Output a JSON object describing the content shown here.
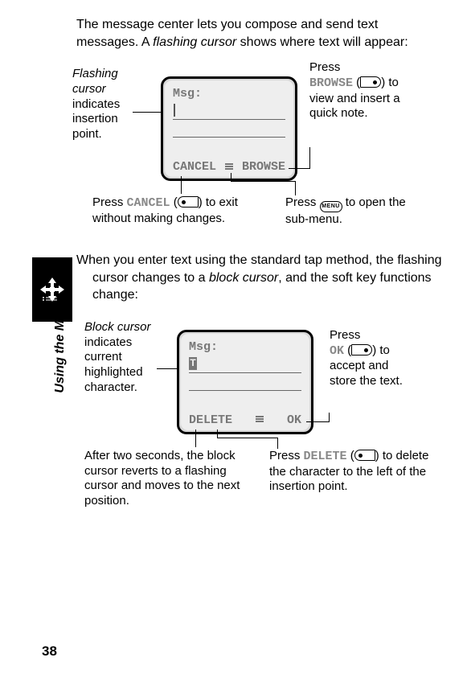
{
  "page_number": "38",
  "side_label": "Using the Menu",
  "intro1_part1": "The message center lets you compose and send text messages. A ",
  "intro1_italic": "flashing cursor",
  "intro1_part2": " shows where text will appear:",
  "intro2_part1": "When you enter text using the standard tap method, the flashing cursor changes to a ",
  "intro2_italic": "block cursor",
  "intro2_part2": ", and the soft key functions change:",
  "phone1": {
    "label": "Msg:",
    "left_softkey": "CANCEL",
    "right_softkey": "BROWSE"
  },
  "phone2": {
    "label": "Msg:",
    "block_char": "T",
    "left_softkey": "DELETE",
    "right_softkey": "OK"
  },
  "callouts1": {
    "flashing_head": "Flashing cursor",
    "flashing_body": " indicates insertion point.",
    "browse_pre": "Press ",
    "browse_key": "BROWSE",
    "browse_post": " to view and insert a quick note.",
    "cancel_pre": "Press ",
    "cancel_key": "CANCEL",
    "cancel_post": " to exit without making changes.",
    "menu_pre": "Press ",
    "menu_label": "MENU",
    "menu_post": " to open the sub-menu."
  },
  "callouts2": {
    "block_head": "Block cursor",
    "block_body": " indicates current highlighted character.",
    "ok_pre": "Press ",
    "ok_key": "OK",
    "ok_post": " to accept and store the text.",
    "revert": "After two seconds, the block cursor reverts to a flashing cursor and moves to the next position.",
    "delete_pre": "Press ",
    "delete_key": "DELETE",
    "delete_post": " to delete the character to the left of the insertion point."
  }
}
